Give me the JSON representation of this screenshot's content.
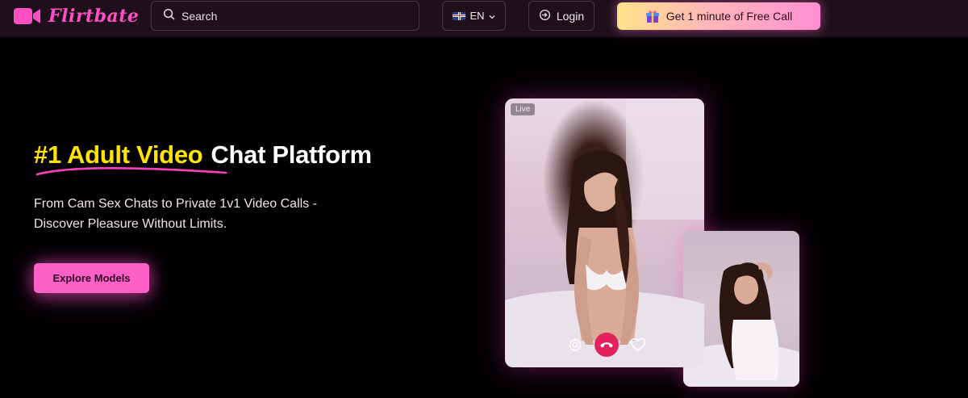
{
  "header": {
    "logo_text": "Flirtbate",
    "search_placeholder": "Search",
    "language_label": "EN",
    "login_label": "Login",
    "cta_label": "Get 1 minute of Free Call"
  },
  "hero": {
    "headline_highlight": "#1 Adult Video",
    "headline_rest": "Chat Platform",
    "subtitle_line1": "From Cam Sex Chats to Private 1v1 Video Calls -",
    "subtitle_line2": "Discover Pleasure Without Limits.",
    "explore_label": "Explore Models"
  },
  "video": {
    "live_badge": "Live"
  },
  "colors": {
    "brand_pink": "#ff5fc9",
    "headline_yellow": "#ffe400",
    "hangup_red": "#e3225b",
    "header_bg": "#1f0f1a"
  },
  "icons": [
    "video-camera-icon",
    "search-icon",
    "flag-uk-icon",
    "chevron-down-icon",
    "login-icon",
    "gift-icon",
    "settings-icon",
    "hangup-icon",
    "heart-icon"
  ]
}
